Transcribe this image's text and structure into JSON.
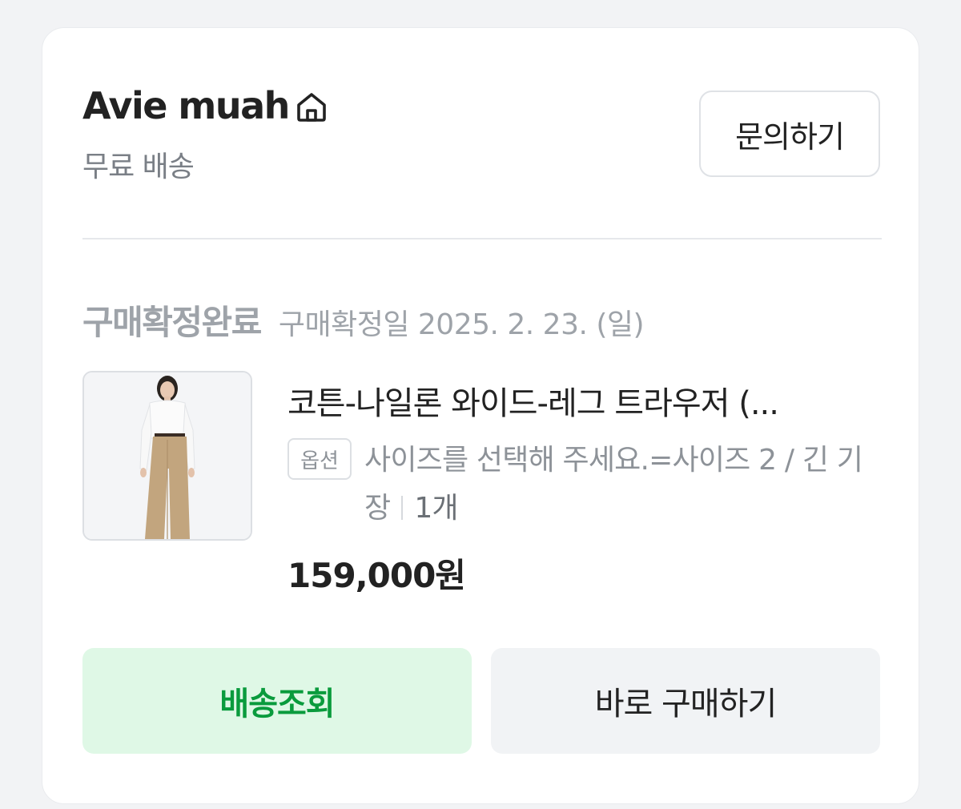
{
  "store": {
    "name": "Avie muah",
    "shipping": "무료 배송",
    "inquiry_label": "문의하기"
  },
  "order": {
    "status": "구매확정완료",
    "confirm_date": "구매확정일 2025. 2. 23. (일)"
  },
  "product": {
    "title": "코튼-나일론 와이드-레그 트라우저 (...",
    "option_tag": "옵션",
    "option_value": "사이즈를 선택해 주세요.=사이즈 2 / 긴 기장",
    "quantity": "1개",
    "price": "159,000원"
  },
  "actions": {
    "track_label": "배송조회",
    "buy_again_label": "바로 구매하기"
  },
  "colors": {
    "accent_green": "#0a9b3d",
    "accent_green_bg": "#dff8e6",
    "muted_text": "#9ea3a9"
  }
}
